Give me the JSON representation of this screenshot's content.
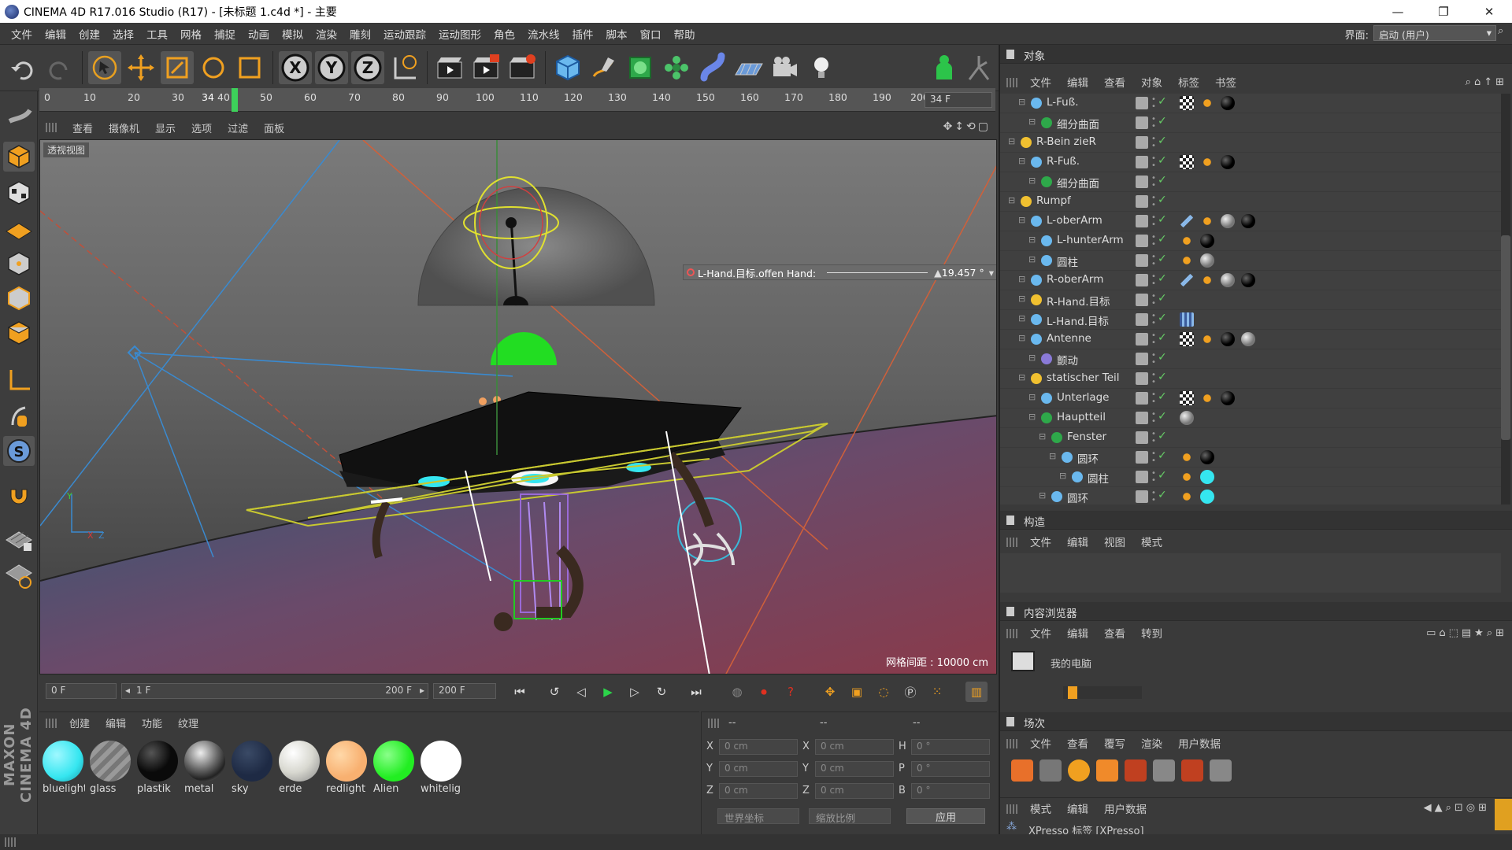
{
  "window": {
    "title": "CINEMA 4D R17.016 Studio (R17) - [未标题 1.c4d *] - 主要",
    "min_label": "—",
    "max_label": "❐",
    "close_label": "✕"
  },
  "menu": [
    "文件",
    "编辑",
    "创建",
    "选择",
    "工具",
    "网格",
    "捕捉",
    "动画",
    "模拟",
    "渲染",
    "雕刻",
    "运动跟踪",
    "运动图形",
    "角色",
    "流水线",
    "插件",
    "脚本",
    "窗口",
    "帮助"
  ],
  "interface": {
    "label": "界面:",
    "value": "启动 (用户)"
  },
  "timeline": {
    "ticks": [
      "0",
      "10",
      "20",
      "30",
      "34",
      "40",
      "50",
      "60",
      "70",
      "80",
      "90",
      "100",
      "110",
      "120",
      "130",
      "140",
      "150",
      "160",
      "170",
      "180",
      "190",
      "200"
    ],
    "current_frame": "34 F"
  },
  "viewport": {
    "menu": [
      "查看",
      "摄像机",
      "显示",
      "选项",
      "过滤",
      "面板"
    ],
    "label": "透视视图",
    "grid_label": "网格间距 : 10000 cm",
    "hud_text": "L-Hand.目标.offen Hand:",
    "hud_value": "19.457 °"
  },
  "playback": {
    "start": "0 F",
    "range_start": "1 F",
    "range_end": "200 F",
    "end": "200 F"
  },
  "materials": {
    "menu": [
      "创建",
      "编辑",
      "功能",
      "纹理"
    ],
    "items": [
      {
        "name": "bluelight",
        "color": "#35e6f0"
      },
      {
        "name": "glass",
        "color": "#8a8a8a"
      },
      {
        "name": "plastik",
        "color": "#0a0a0a"
      },
      {
        "name": "metal",
        "color": "#9a9a9a"
      },
      {
        "name": "sky",
        "color": "#1e2a44"
      },
      {
        "name": "erde",
        "color": "#d8d8d0"
      },
      {
        "name": "redlight",
        "color": "#f8b070"
      },
      {
        "name": "Alien",
        "color": "#22ee22"
      },
      {
        "name": "whitelig",
        "color": "#ffffff"
      }
    ]
  },
  "coords": {
    "header": [
      "--",
      "--",
      "--"
    ],
    "rows": [
      {
        "a": "X",
        "av": "0 cm",
        "b": "X",
        "bv": "0 cm",
        "c": "H",
        "cv": "0 °"
      },
      {
        "a": "Y",
        "av": "0 cm",
        "b": "Y",
        "bv": "0 cm",
        "c": "P",
        "cv": "0 °"
      },
      {
        "a": "Z",
        "av": "0 cm",
        "b": "Z",
        "bv": "0 cm",
        "c": "B",
        "cv": "0 °"
      }
    ],
    "world": "世界坐标",
    "scale": "缩放比例",
    "apply": "应用"
  },
  "objects": {
    "title": "对象",
    "menu": [
      "文件",
      "编辑",
      "查看",
      "对象",
      "标签",
      "书签"
    ],
    "rows": [
      {
        "name": "L-Fuß.",
        "indent": 1
      },
      {
        "name": "细分曲面",
        "indent": 2
      },
      {
        "name": "R-Bein zieR",
        "indent": 0
      },
      {
        "name": "R-Fuß.",
        "indent": 1
      },
      {
        "name": "细分曲面",
        "indent": 2
      },
      {
        "name": "Rumpf",
        "indent": 0
      },
      {
        "name": "L-oberArm",
        "indent": 1
      },
      {
        "name": "L-hunterArm",
        "indent": 2
      },
      {
        "name": "圆柱",
        "indent": 2
      },
      {
        "name": "R-oberArm",
        "indent": 1
      },
      {
        "name": "R-Hand.目标",
        "indent": 1
      },
      {
        "name": "L-Hand.目标",
        "indent": 1
      },
      {
        "name": "Antenne",
        "indent": 1
      },
      {
        "name": "颤动",
        "indent": 2
      },
      {
        "name": "statischer Teil",
        "indent": 1
      },
      {
        "name": "Unterlage",
        "indent": 2
      },
      {
        "name": "Hauptteil",
        "indent": 2
      },
      {
        "name": "Fenster",
        "indent": 3
      },
      {
        "name": "圆环",
        "indent": 4
      },
      {
        "name": "圆柱",
        "indent": 5
      },
      {
        "name": "圆环",
        "indent": 3
      }
    ]
  },
  "structure": {
    "title": "构造",
    "menu": [
      "文件",
      "编辑",
      "视图",
      "模式"
    ]
  },
  "browser": {
    "title": "内容浏览器",
    "menu": [
      "文件",
      "编辑",
      "查看",
      "转到"
    ],
    "item": "我的电脑"
  },
  "takes": {
    "title": "场次",
    "menu": [
      "文件",
      "查看",
      "覆写",
      "渲染",
      "用户数据"
    ]
  },
  "attributes": {
    "menu": [
      "模式",
      "编辑",
      "用户数据"
    ],
    "item": "XPresso 标签 [XPresso]"
  }
}
